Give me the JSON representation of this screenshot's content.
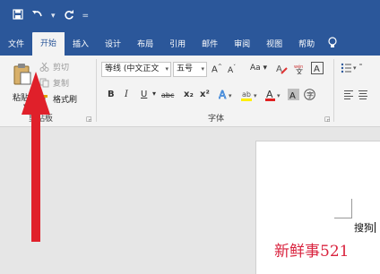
{
  "qat": {
    "save_icon": "save-icon",
    "undo_icon": "undo-icon",
    "redo_icon": "redo-icon",
    "customize": "="
  },
  "tabs": [
    {
      "label": "文件",
      "active": false
    },
    {
      "label": "开始",
      "active": true
    },
    {
      "label": "插入",
      "active": false
    },
    {
      "label": "设计",
      "active": false
    },
    {
      "label": "布局",
      "active": false
    },
    {
      "label": "引用",
      "active": false
    },
    {
      "label": "邮件",
      "active": false
    },
    {
      "label": "审阅",
      "active": false
    },
    {
      "label": "视图",
      "active": false
    },
    {
      "label": "帮助",
      "active": false
    }
  ],
  "clipboard": {
    "paste_label": "粘贴",
    "cut_label": "剪切",
    "copy_label": "复制",
    "format_painter_label": "格式刷",
    "group_label": "剪贴板"
  },
  "font": {
    "font_name": "等线 (中文正文",
    "font_size": "五号",
    "grow": "A",
    "shrink": "A",
    "change_case": "Aa",
    "bold": "B",
    "italic": "I",
    "underline": "U",
    "strike": "abc",
    "subscript": "x₂",
    "superscript": "x²",
    "group_label": "字体"
  },
  "document": {
    "text": "搜狗"
  },
  "watermark": "新鲜事521",
  "colors": {
    "ribbon_blue": "#2b579a",
    "arrow_red": "#e0202a",
    "watermark_red": "#d9233e",
    "highlight_yellow": "#ffef00",
    "font_color_red": "#e02020"
  }
}
